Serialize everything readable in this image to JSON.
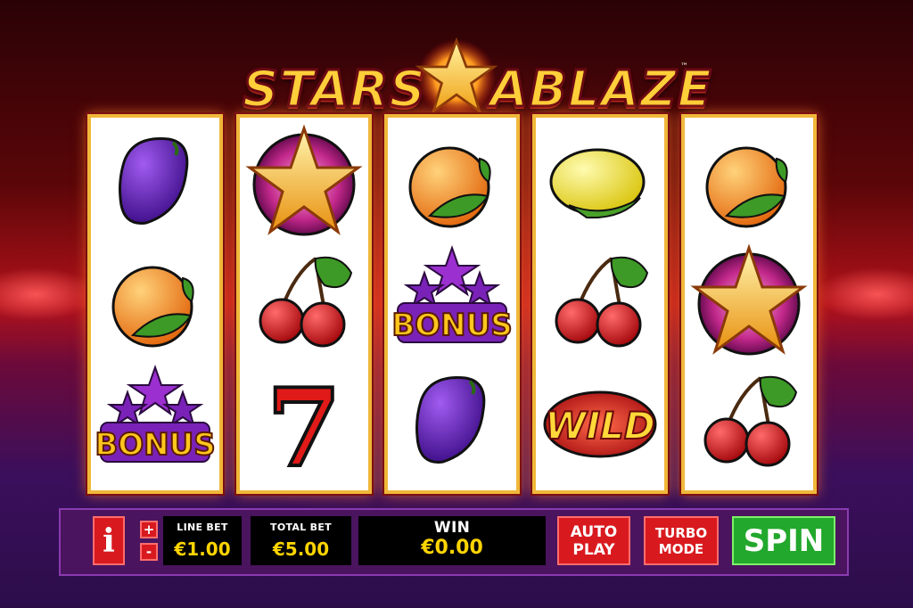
{
  "logo": {
    "word1": "STARS",
    "word2": "ABLAZE",
    "tm": "™"
  },
  "reels": [
    [
      "plum",
      "orange",
      "bonus"
    ],
    [
      "star",
      "cherry",
      "seven"
    ],
    [
      "orange",
      "bonus",
      "plum"
    ],
    [
      "lemon",
      "cherry",
      "wild"
    ],
    [
      "orange",
      "star",
      "cherry"
    ]
  ],
  "symbol_text": {
    "bonus": "BONUS",
    "wild": "WILD",
    "seven": "7"
  },
  "controls": {
    "info_label": "i",
    "plus_label": "+",
    "minus_label": "-",
    "line_bet_label": "LINE BET",
    "line_bet_value": "€1.00",
    "total_bet_label": "TOTAL BET",
    "total_bet_value": "€5.00",
    "win_label": "WIN",
    "win_value": "€0.00",
    "auto_play_label": "AUTO PLAY",
    "turbo_mode_label": "TURBO MODE",
    "spin_label": "SPIN"
  },
  "colors": {
    "accent_red": "#d81a1f",
    "spin_green": "#22a82c",
    "value_yellow": "#ffd400",
    "bar_purple": "#4a145e"
  }
}
